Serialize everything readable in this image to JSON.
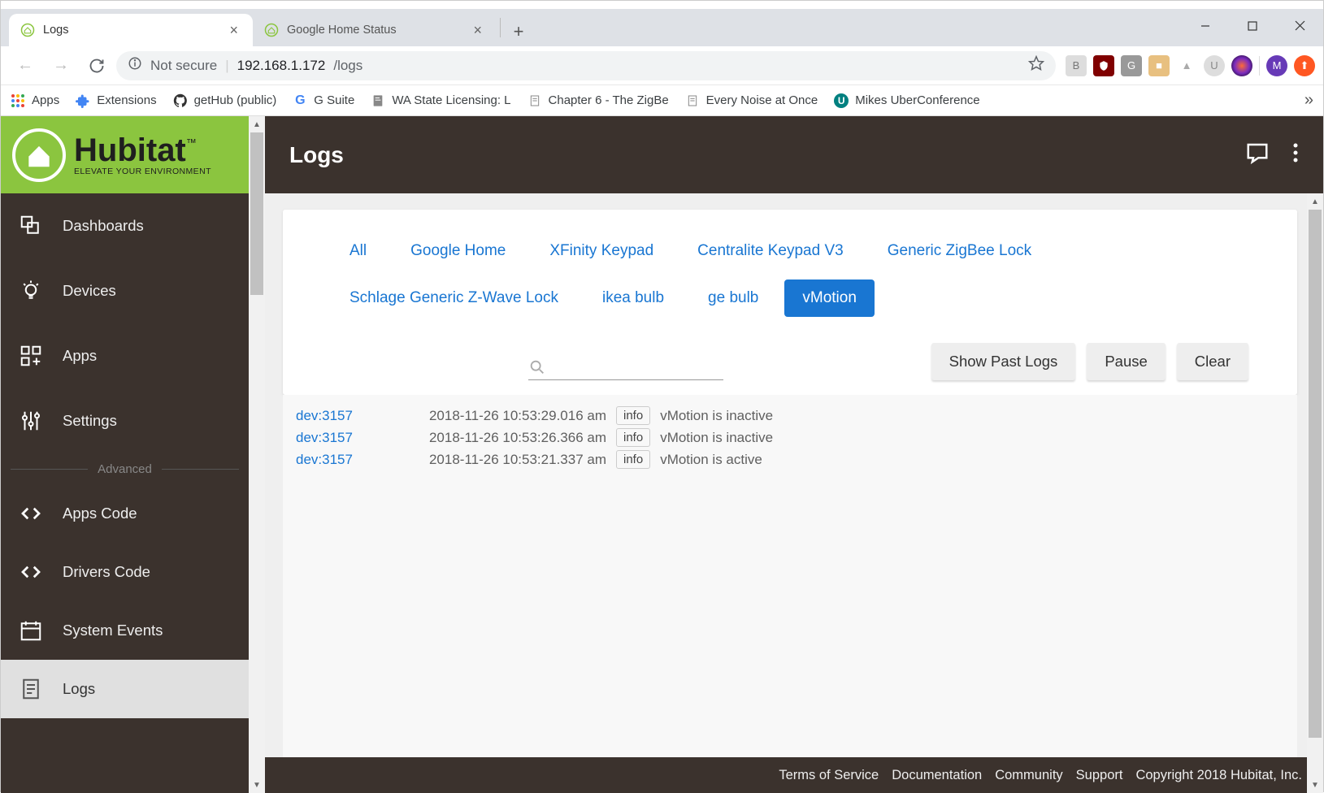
{
  "browser": {
    "tabs": [
      {
        "title": "Logs",
        "active": true
      },
      {
        "title": "Google Home Status",
        "active": false
      }
    ],
    "security_label": "Not secure",
    "url_host": "192.168.1.172",
    "url_path": "/logs",
    "bookmarks": [
      {
        "label": "Apps",
        "icon": "apps"
      },
      {
        "label": "Extensions",
        "icon": "puzzle"
      },
      {
        "label": "getHub (public)",
        "icon": "github"
      },
      {
        "label": "G Suite",
        "icon": "google"
      },
      {
        "label": "WA State Licensing: L",
        "icon": "doc"
      },
      {
        "label": "Chapter 6 - The ZigBe",
        "icon": "doc"
      },
      {
        "label": "Every Noise at Once",
        "icon": "doc"
      },
      {
        "label": "Mikes UberConference",
        "icon": "uber"
      }
    ]
  },
  "sidebar": {
    "brand_main": "Hubitat",
    "brand_sub": "ELEVATE YOUR ENVIRONMENT",
    "tm": "™",
    "items": [
      {
        "label": "Dashboards",
        "icon": "dashboards"
      },
      {
        "label": "Devices",
        "icon": "devices"
      },
      {
        "label": "Apps",
        "icon": "apps-grid"
      },
      {
        "label": "Settings",
        "icon": "sliders"
      }
    ],
    "advanced_label": "Advanced",
    "advanced": [
      {
        "label": "Apps Code",
        "icon": "code"
      },
      {
        "label": "Drivers Code",
        "icon": "code"
      },
      {
        "label": "System Events",
        "icon": "calendar"
      },
      {
        "label": "Logs",
        "icon": "document",
        "active": true
      }
    ]
  },
  "page": {
    "title": "Logs",
    "filters": [
      {
        "label": "All"
      },
      {
        "label": "Google Home"
      },
      {
        "label": "XFinity Keypad"
      },
      {
        "label": "Centralite Keypad V3"
      },
      {
        "label": "Generic ZigBee Lock"
      },
      {
        "label": "Schlage Generic Z-Wave Lock"
      },
      {
        "label": "ikea bulb"
      },
      {
        "label": "ge bulb"
      },
      {
        "label": "vMotion",
        "active": true
      }
    ],
    "buttons": {
      "past": "Show Past Logs",
      "pause": "Pause",
      "clear": "Clear"
    },
    "logs": [
      {
        "dev": "dev:3157",
        "time": "2018-11-26 10:53:29.016 am",
        "level": "info",
        "msg": "vMotion is inactive"
      },
      {
        "dev": "dev:3157",
        "time": "2018-11-26 10:53:26.366 am",
        "level": "info",
        "msg": "vMotion is inactive"
      },
      {
        "dev": "dev:3157",
        "time": "2018-11-26 10:53:21.337 am",
        "level": "info",
        "msg": "vMotion is active"
      }
    ]
  },
  "footer": {
    "links": [
      "Terms of Service",
      "Documentation",
      "Community",
      "Support"
    ],
    "copyright": "Copyright 2018 Hubitat, Inc."
  }
}
